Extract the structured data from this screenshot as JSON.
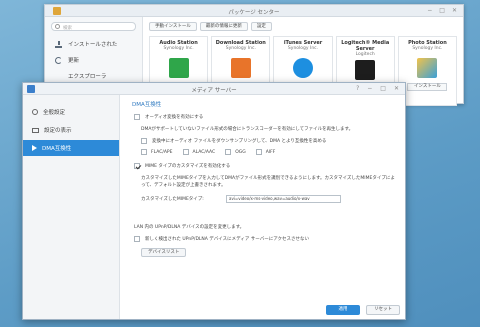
{
  "package_center": {
    "title": "パッケージ センター",
    "search_placeholder": "検索",
    "sidebar": [
      "インストールされた",
      "更新",
      "エクスプローラ"
    ],
    "toolbar": [
      "手動インストール",
      "最新の情報に更新",
      "設定"
    ],
    "packages": [
      {
        "name": "Audio Station",
        "vendor": "Synology Inc.",
        "icon": "audio-station-icon",
        "color": "#2fa64a"
      },
      {
        "name": "Download Station",
        "vendor": "Synology Inc.",
        "icon": "download-station-icon",
        "color": "#e8742a"
      },
      {
        "name": "iTunes Server",
        "vendor": "Synology Inc.",
        "icon": "itunes-server-icon",
        "color": "#1d8fe0"
      },
      {
        "name": "Logitech® Media Server",
        "vendor": "Logitech",
        "icon": "logitech-icon",
        "color": "#1d1d1d"
      },
      {
        "name": "Photo Station",
        "vendor": "Synology Inc.",
        "icon": "photo-station-icon",
        "color": "#d9a82e",
        "install_label": "インストール"
      }
    ]
  },
  "media_server": {
    "title": "メディア サーバー",
    "window_controls": [
      "?",
      "−",
      "□",
      "✕"
    ],
    "sidebar": [
      {
        "label": "全般設定",
        "icon": "gear-icon"
      },
      {
        "label": "設定の表示",
        "icon": "display-icon"
      },
      {
        "label": "DMA互換性",
        "icon": "play-icon",
        "active": true
      }
    ],
    "section_title": "DMA互換性",
    "options": {
      "transcode_label": "オーディオ変換を有効にする",
      "transcode_desc": "DMAがサポートしていないファイル形式の場合にトランスコーダーを有効にしてファイルを再生します。",
      "downsample_label": "変換中にオーディオ ファイルをダウンサンプリングして、DMA とより互換性を高める",
      "formats": [
        "FLAC/APE",
        "ALAC/AAC",
        "OGG",
        "AIFF"
      ],
      "mime_label": "MIME タイプのカスタマイズを有効化する",
      "mime_desc": "カスタマイズしたMIMEタイプを入力してDMAがファイル形式を識別できるようにします。カスタマイズしたMIMEタイプによって、デフォルト設定が上書きされます。",
      "mime_field_label": "カスタマイズしたMIMEタイプ:",
      "mime_field_value": "avi=video/x-ms-video,wav=audio/x-wav",
      "lan_desc": "LAN 内の UPnP/DLNA デバイスの設定を変更します。",
      "new_device_label": "新しく検出された UPnP/DLNA デバイスにメディア サーバーにアクセスさせない",
      "device_list_label": "デバイスリスト"
    },
    "buttons": {
      "ok": "適用",
      "reset": "リセット"
    }
  }
}
